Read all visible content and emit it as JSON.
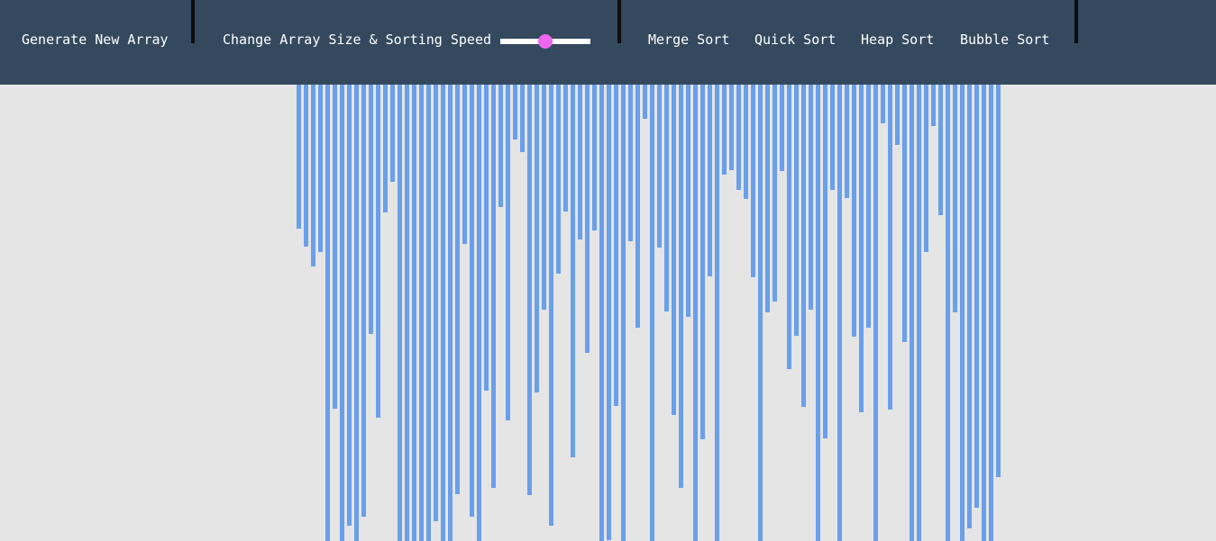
{
  "nav": {
    "generate_label": "Generate New Array",
    "size_speed_label": "Change Array Size & Sorting Speed",
    "slider_fraction": 0.5,
    "algorithms": [
      "Merge Sort",
      "Quick Sort",
      "Heap Sort",
      "Bubble Sort"
    ]
  },
  "colors": {
    "nav_background": "#34495e",
    "page_background": "#e5e5e5",
    "bar": "#6a9fea",
    "slider_thumb": "#ee66ee",
    "divider": "#0d0d0d"
  },
  "array": {
    "values": [
      160,
      180,
      202,
      186,
      507,
      360,
      507,
      490,
      507,
      480,
      277,
      370,
      142,
      108,
      507,
      507,
      507,
      507,
      507,
      485,
      507,
      507,
      455,
      177,
      480,
      507,
      340,
      448,
      136,
      373,
      61,
      75,
      456,
      342,
      250,
      490,
      210,
      141,
      414,
      172,
      298,
      162,
      507,
      506,
      357,
      507,
      174,
      270,
      38,
      507,
      181,
      252,
      367,
      448,
      258,
      507,
      394,
      213,
      507,
      100,
      95,
      117,
      127,
      214,
      507,
      253,
      241,
      96,
      316,
      279,
      358,
      250,
      507,
      393,
      117,
      507,
      126,
      280,
      364,
      270,
      507,
      43,
      361,
      67,
      286,
      507,
      507,
      186,
      46,
      145,
      507,
      253,
      507,
      493,
      470,
      507,
      507,
      436
    ]
  }
}
